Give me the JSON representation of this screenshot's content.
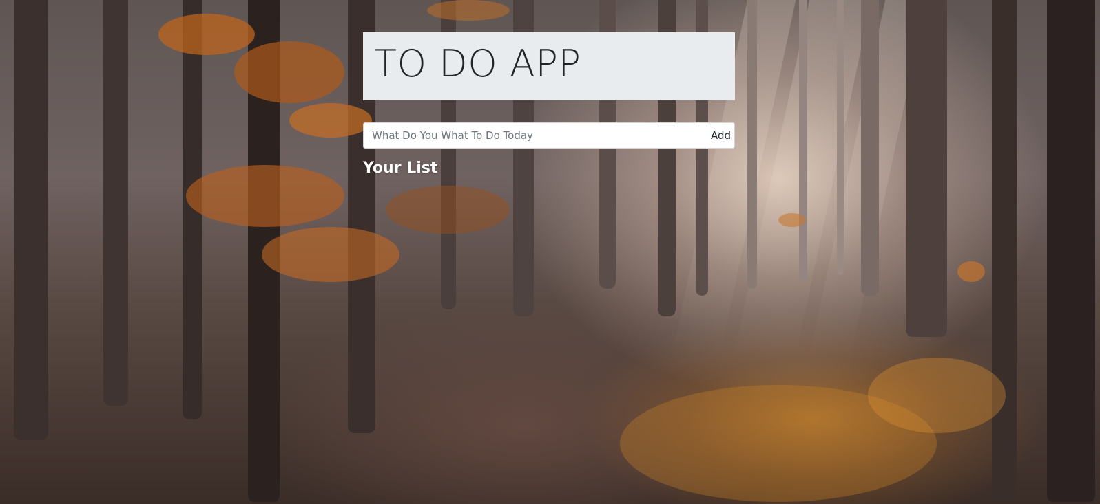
{
  "app": {
    "title": "TO DO APP"
  },
  "form": {
    "input_value": "",
    "input_placeholder": "What Do You What To Do Today",
    "add_label": "Add"
  },
  "list": {
    "heading": "Your List",
    "items": []
  },
  "colors": {
    "jumbotron_bg": "#e9ecef",
    "heading_text": "#ffffff",
    "title_text": "#212529"
  },
  "background": {
    "description_icon": "forest-background-image"
  }
}
